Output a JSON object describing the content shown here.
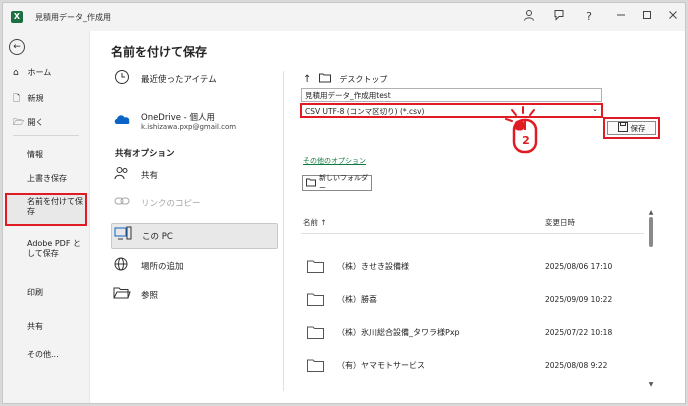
{
  "window": {
    "title": "見積用データ_作成用"
  },
  "titlebar": {
    "logo_letter": "X",
    "icons": [
      "person-icon",
      "feedback-icon",
      "help-icon",
      "minimize-icon",
      "maximize-icon",
      "close-icon"
    ],
    "help_glyph": "?"
  },
  "nav": {
    "back_glyph": "←",
    "home": "ホーム",
    "new": "新規",
    "open": "開く",
    "info": "情報",
    "save": "上書き保存",
    "save_as": "名前を付けて保存",
    "adobe": "Adobe PDF として保存",
    "print": "印刷",
    "share": "共有",
    "more": "その他..."
  },
  "page": {
    "title": "名前を付けて保存"
  },
  "locations": {
    "recent": "最近使ったアイテム",
    "onedrive_name": "OneDrive - 個人用",
    "onedrive_email": "k.ishizawa.pxp@gmail.com",
    "shared_header": "共有オプション",
    "share": "共有",
    "copy_link": "リンクのコピー",
    "this_pc": "この PC",
    "add_place": "場所の追加",
    "browse": "参照"
  },
  "save_panel": {
    "path_up": "↑",
    "folder": "デスクトップ",
    "filename": "見積用データ_作成用test",
    "filetype": "CSV UTF-8 (コンマ区切り) (*.csv)",
    "save_label": "保存",
    "more_options": "その他のオプション",
    "new_folder": "新しいフォルダー"
  },
  "file_list": {
    "columns": [
      "名前 ↑",
      "変更日時"
    ],
    "rows": [
      {
        "name": "（株）きせき設備様",
        "date": "2025/08/06 17:10"
      },
      {
        "name": "（株）勝喜",
        "date": "2025/09/09 10:22"
      },
      {
        "name": "（株）氷川総合設備_タワラ様Pxp",
        "date": "2025/07/22 10:18"
      },
      {
        "name": "（有）ヤマモトサービス",
        "date": "2025/08/08 9:22"
      }
    ]
  },
  "annotation": {
    "step": "2"
  },
  "colors": {
    "accent_red": "#e01b24",
    "excel_green": "#1d6f42",
    "link_green": "#107c41"
  }
}
